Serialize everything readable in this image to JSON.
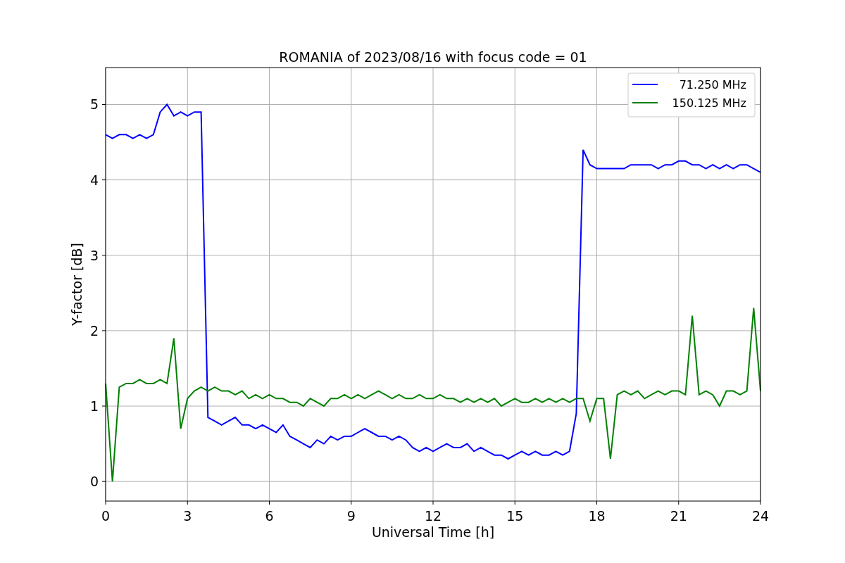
{
  "figure": {
    "chart_data": {
      "type": "line",
      "title": "ROMANIA of 2023/08/16 with focus code = 01",
      "xlabel": "Universal Time [h]",
      "ylabel": "Y-factor [dB]",
      "x": [
        0,
        0.25,
        0.5,
        0.75,
        1,
        1.25,
        1.5,
        1.75,
        2,
        2.25,
        2.5,
        2.75,
        3,
        3.25,
        3.5,
        3.75,
        4,
        4.25,
        4.5,
        4.75,
        5,
        5.25,
        5.5,
        5.75,
        6,
        6.25,
        6.5,
        6.75,
        7,
        7.25,
        7.5,
        7.75,
        8,
        8.25,
        8.5,
        8.75,
        9,
        9.25,
        9.5,
        9.75,
        10,
        10.25,
        10.5,
        10.75,
        11,
        11.25,
        11.5,
        11.75,
        12,
        12.25,
        12.5,
        12.75,
        13,
        13.25,
        13.5,
        13.75,
        14,
        14.25,
        14.5,
        14.75,
        15,
        15.25,
        15.5,
        15.75,
        16,
        16.25,
        16.5,
        16.75,
        17,
        17.25,
        17.5,
        17.75,
        18,
        18.25,
        18.5,
        18.75,
        19,
        19.25,
        19.5,
        19.75,
        20,
        20.25,
        20.5,
        20.75,
        21,
        21.25,
        21.5,
        21.75,
        22,
        22.25,
        22.5,
        22.75,
        23,
        23.25,
        23.5,
        23.75,
        24
      ],
      "series": [
        {
          "name": "71.250 MHz",
          "color": "#0000ff",
          "values": [
            4.6,
            4.55,
            4.6,
            4.6,
            4.55,
            4.6,
            4.55,
            4.6,
            4.9,
            5.0,
            4.85,
            4.9,
            4.85,
            4.9,
            4.9,
            0.85,
            0.8,
            0.75,
            0.8,
            0.85,
            0.75,
            0.75,
            0.7,
            0.75,
            0.7,
            0.65,
            0.75,
            0.6,
            0.55,
            0.5,
            0.45,
            0.55,
            0.5,
            0.6,
            0.55,
            0.6,
            0.6,
            0.65,
            0.7,
            0.65,
            0.6,
            0.6,
            0.55,
            0.6,
            0.55,
            0.45,
            0.4,
            0.45,
            0.4,
            0.45,
            0.5,
            0.45,
            0.45,
            0.5,
            0.4,
            0.45,
            0.4,
            0.35,
            0.35,
            0.3,
            0.35,
            0.4,
            0.35,
            0.4,
            0.35,
            0.35,
            0.4,
            0.35,
            0.4,
            0.9,
            4.4,
            4.2,
            4.15,
            4.15,
            4.15,
            4.15,
            4.15,
            4.2,
            4.2,
            4.2,
            4.2,
            4.15,
            4.2,
            4.2,
            4.25,
            4.25,
            4.2,
            4.2,
            4.15,
            4.2,
            4.15,
            4.2,
            4.15,
            4.2,
            4.2,
            4.15,
            4.1
          ]
        },
        {
          "name": "150.125 MHz",
          "color": "#008000",
          "values": [
            1.3,
            0.0,
            1.25,
            1.3,
            1.3,
            1.35,
            1.3,
            1.3,
            1.35,
            1.3,
            1.9,
            0.7,
            1.1,
            1.2,
            1.25,
            1.2,
            1.25,
            1.2,
            1.2,
            1.15,
            1.2,
            1.1,
            1.15,
            1.1,
            1.15,
            1.1,
            1.1,
            1.05,
            1.05,
            1.0,
            1.1,
            1.05,
            1.0,
            1.1,
            1.1,
            1.15,
            1.1,
            1.15,
            1.1,
            1.15,
            1.2,
            1.15,
            1.1,
            1.15,
            1.1,
            1.1,
            1.15,
            1.1,
            1.1,
            1.15,
            1.1,
            1.1,
            1.05,
            1.1,
            1.05,
            1.1,
            1.05,
            1.1,
            1.0,
            1.05,
            1.1,
            1.05,
            1.05,
            1.1,
            1.05,
            1.1,
            1.05,
            1.1,
            1.05,
            1.1,
            1.1,
            0.8,
            1.1,
            1.1,
            0.3,
            1.15,
            1.2,
            1.15,
            1.2,
            1.1,
            1.15,
            1.2,
            1.15,
            1.2,
            1.2,
            1.15,
            2.2,
            1.15,
            1.2,
            1.15,
            1.0,
            1.2,
            1.2,
            1.15,
            1.2,
            2.3,
            1.2
          ]
        }
      ],
      "grid": true,
      "legend": true,
      "xlim": [
        0,
        24
      ],
      "ylim": [
        -0.26,
        5.49
      ],
      "xticks": [
        0,
        3,
        6,
        9,
        12,
        15,
        18,
        21,
        24
      ],
      "yticks": [
        0,
        1,
        2,
        3,
        4,
        5
      ]
    }
  }
}
